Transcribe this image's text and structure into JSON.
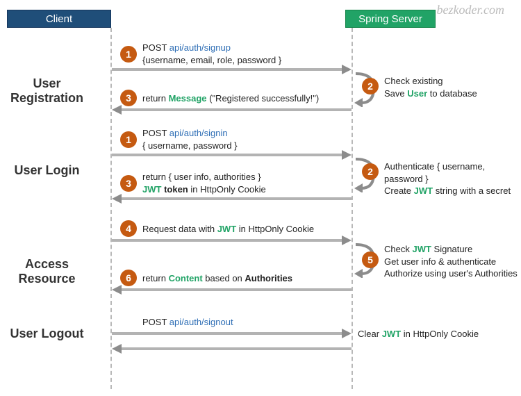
{
  "watermark": "bezkoder.com",
  "boxes": {
    "client": "Client",
    "server": "Spring Server"
  },
  "sections": {
    "registration": "User Registration",
    "login": "User Login",
    "access": "Access Resource",
    "logout": "User Logout"
  },
  "reg": {
    "s1_verb": "POST ",
    "s1_path": "api/auth/signup",
    "s1_body": "{username, email, role, password }",
    "s2a": "Check existing",
    "s2b_pre": "Save ",
    "s2b_hi": "User",
    "s2b_post": " to database",
    "s3_pre": "return ",
    "s3_hi": "Message",
    "s3_post": " (\"Registered successfully!\")"
  },
  "login": {
    "s1_verb": "POST ",
    "s1_path": "api/auth/signin",
    "s1_body": "{ username, password }",
    "s2a": "Authenticate { username, password }",
    "s2b_pre": "Create ",
    "s2b_hi": "JWT",
    "s2b_post": " string with a secret",
    "s3a": "return { user info, authorities }",
    "s3b_hi": "JWT",
    "s3b_mid": " token",
    "s3b_post": " in HttpOnly Cookie"
  },
  "access": {
    "s4_pre": "Request data with ",
    "s4_hi": "JWT",
    "s4_post": " in HttpOnly Cookie",
    "s5a_pre": "Check ",
    "s5a_hi": "JWT",
    "s5a_post": " Signature",
    "s5b": "Get user info & authenticate",
    "s5c": "Authorize using user's Authorities",
    "s6_pre": "return ",
    "s6_hi1": "Content",
    "s6_mid": " based on ",
    "s6_hi2": "Authorities"
  },
  "logout": {
    "verb": "POST ",
    "path": "api/auth/signout",
    "resp_pre": "Clear ",
    "resp_hi": "JWT",
    "resp_post": " in HttpOnly Cookie"
  },
  "nums": {
    "n1": "1",
    "n2": "2",
    "n3": "3",
    "n4": "4",
    "n5": "5",
    "n6": "6"
  }
}
